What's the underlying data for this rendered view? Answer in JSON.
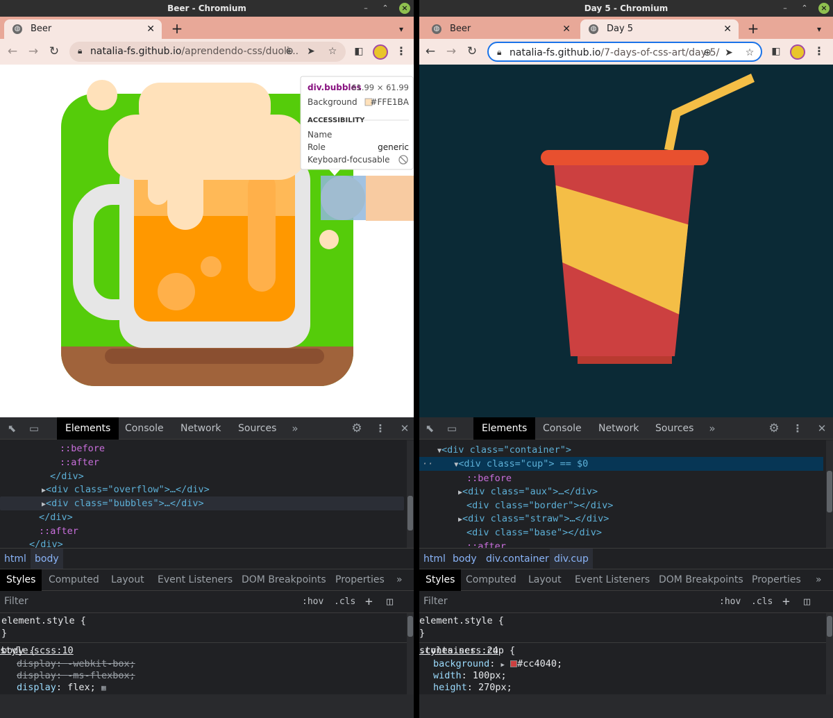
{
  "left": {
    "title": "Beer - Chromium",
    "tabs": [
      {
        "label": "Beer"
      }
    ],
    "url_host": "natalia-fs.github.io",
    "url_path": "/aprendendo-css/duoli...",
    "tooltip": {
      "selector": "div.bubbles",
      "dims": "61.99 × 61.99",
      "bg_label": "Background",
      "bg_value": "#FFE1BA",
      "acc_header": "ACCESSIBILITY",
      "name_label": "Name",
      "role_label": "Role",
      "role_value": "generic",
      "kb_label": "Keyboard-focusable"
    },
    "devtools": {
      "tabs": [
        "Elements",
        "Console",
        "Network",
        "Sources"
      ],
      "lines": [
        "::before",
        "::after",
        "</div>",
        "<div class=\"overflow\">…</div>",
        "<div class=\"bubbles\">…</div>",
        "</div>",
        "::after",
        "</div>"
      ],
      "crumbs": [
        "html",
        "body"
      ],
      "subtabs": [
        "Styles",
        "Computed",
        "Layout",
        "Event Listeners",
        "DOM Breakpoints",
        "Properties"
      ],
      "filter": "Filter",
      "hov": ":hov",
      "cls": ".cls",
      "element_style": "element.style {",
      "rule_selector": "body {",
      "rule_source": "style.scss:10",
      "rule_props": [
        {
          "name": "display",
          "value": "-webkit-box;",
          "struck": true
        },
        {
          "name": "display",
          "value": "-ms-flexbox;",
          "struck": true
        },
        {
          "name": "display",
          "value": "flex;",
          "struck": false
        }
      ]
    }
  },
  "right": {
    "title": "Day 5 - Chromium",
    "tabs": [
      {
        "label": "Beer"
      },
      {
        "label": "Day 5"
      }
    ],
    "url_host": "natalia-fs.github.io",
    "url_path": "/7-days-of-css-art/day-5/",
    "devtools": {
      "tabs": [
        "Elements",
        "Console",
        "Network",
        "Sources"
      ],
      "lines": [
        "<div class=\"container\">",
        "<div class=\"cup\"> == $0",
        "::before",
        "<div class=\"aux\">…</div>",
        "<div class=\"border\"></div>",
        "<div class=\"straw\">…</div>",
        "<div class=\"base\"></div>",
        "::after"
      ],
      "crumbs": [
        "html",
        "body",
        "div.container",
        "div.cup"
      ],
      "subtabs": [
        "Styles",
        "Computed",
        "Layout",
        "Event Listeners",
        "DOM Breakpoints",
        "Properties"
      ],
      "filter": "Filter",
      "hov": ":hov",
      "cls": ".cls",
      "element_style": "element.style {",
      "rule_selector": ".container .cup {",
      "rule_source": "styles.scss:24",
      "rule_props": [
        {
          "name": "background",
          "value": "#cc4040;",
          "swatch": "#cc4040"
        },
        {
          "name": "width",
          "value": "100px;"
        },
        {
          "name": "height",
          "value": "270px;"
        }
      ]
    }
  },
  "colors": {
    "beer_bg": "#55cc0a",
    "foam": "#ffe1ba",
    "beer": "#ff9800",
    "soil": "#a0633b",
    "cup_red": "#cc4040",
    "stripe": "#f4be46",
    "dark_bg": "#0b2a36"
  }
}
